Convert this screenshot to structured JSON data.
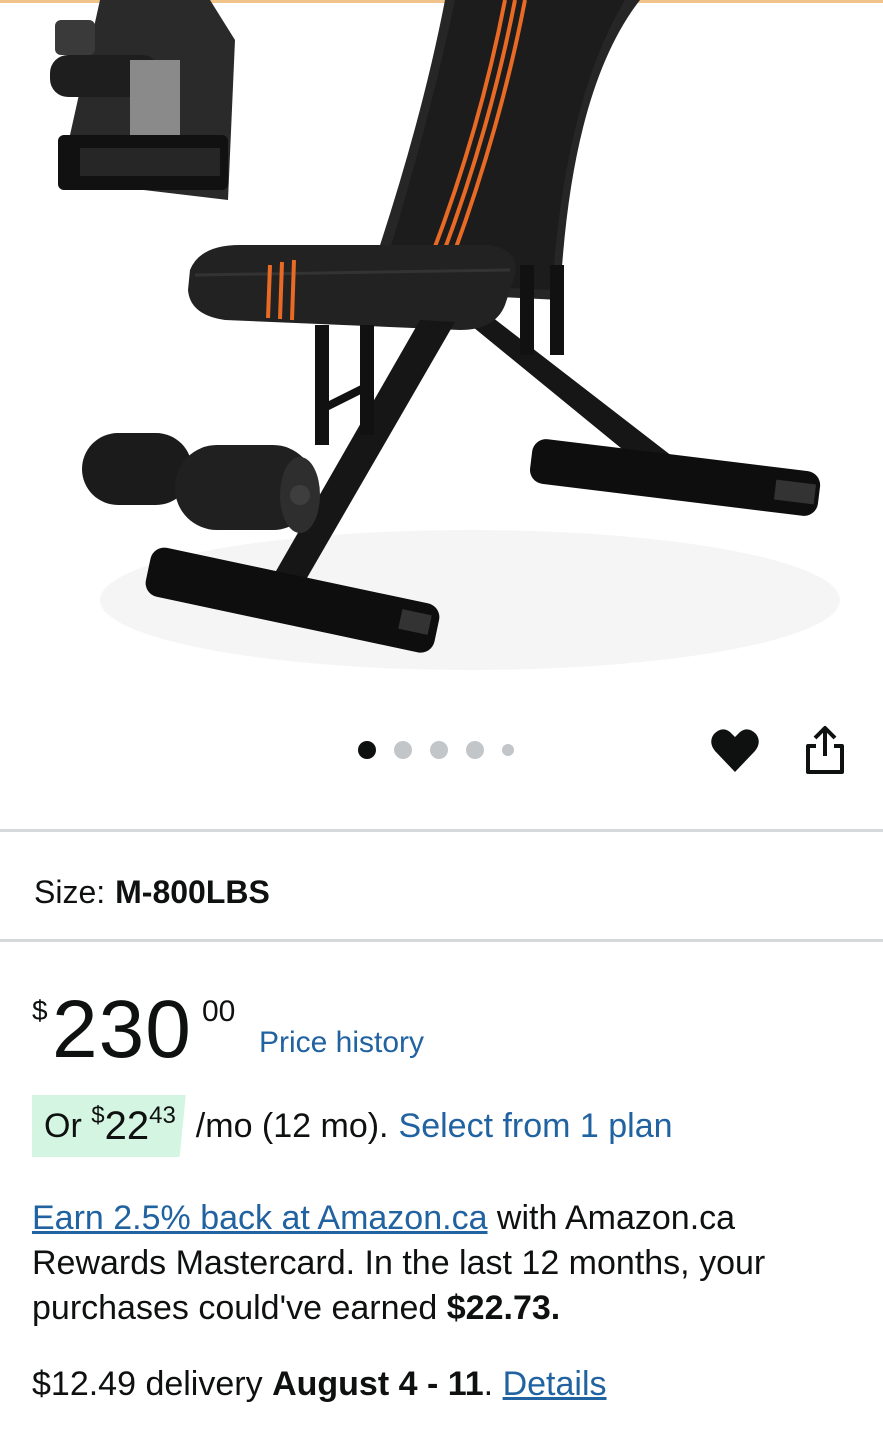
{
  "gallery": {
    "image_alt": "Adjustable weight bench",
    "dots_count": 5,
    "active_index": 0
  },
  "actions": {
    "wishlist_icon": "heart-icon",
    "share_icon": "share-icon"
  },
  "size": {
    "label": "Size:",
    "value": "M-800LBS"
  },
  "price": {
    "currency": "$",
    "whole": "230",
    "fraction": "00",
    "history_link": "Price history"
  },
  "installment": {
    "prefix": "Or",
    "currency": "$",
    "whole": "22",
    "fraction": "43",
    "terms": "/mo (12 mo).",
    "plan_link": "Select from 1 plan"
  },
  "rewards": {
    "link": "Earn 2.5% back at Amazon.ca",
    "text1": " with Amazon.ca Rewards Mastercard. In the last 12 months, your purchases could've earned ",
    "amount": "$22.73."
  },
  "delivery": {
    "price": "$12.49 delivery",
    "dates": "August 4 - 11",
    "period": ".",
    "details_link": "Details"
  },
  "colors": {
    "link": "#2162a1",
    "installment_bg": "#d5f5e3",
    "accent_stripe": "#e86a25",
    "bench_black": "#1a1a1a"
  }
}
